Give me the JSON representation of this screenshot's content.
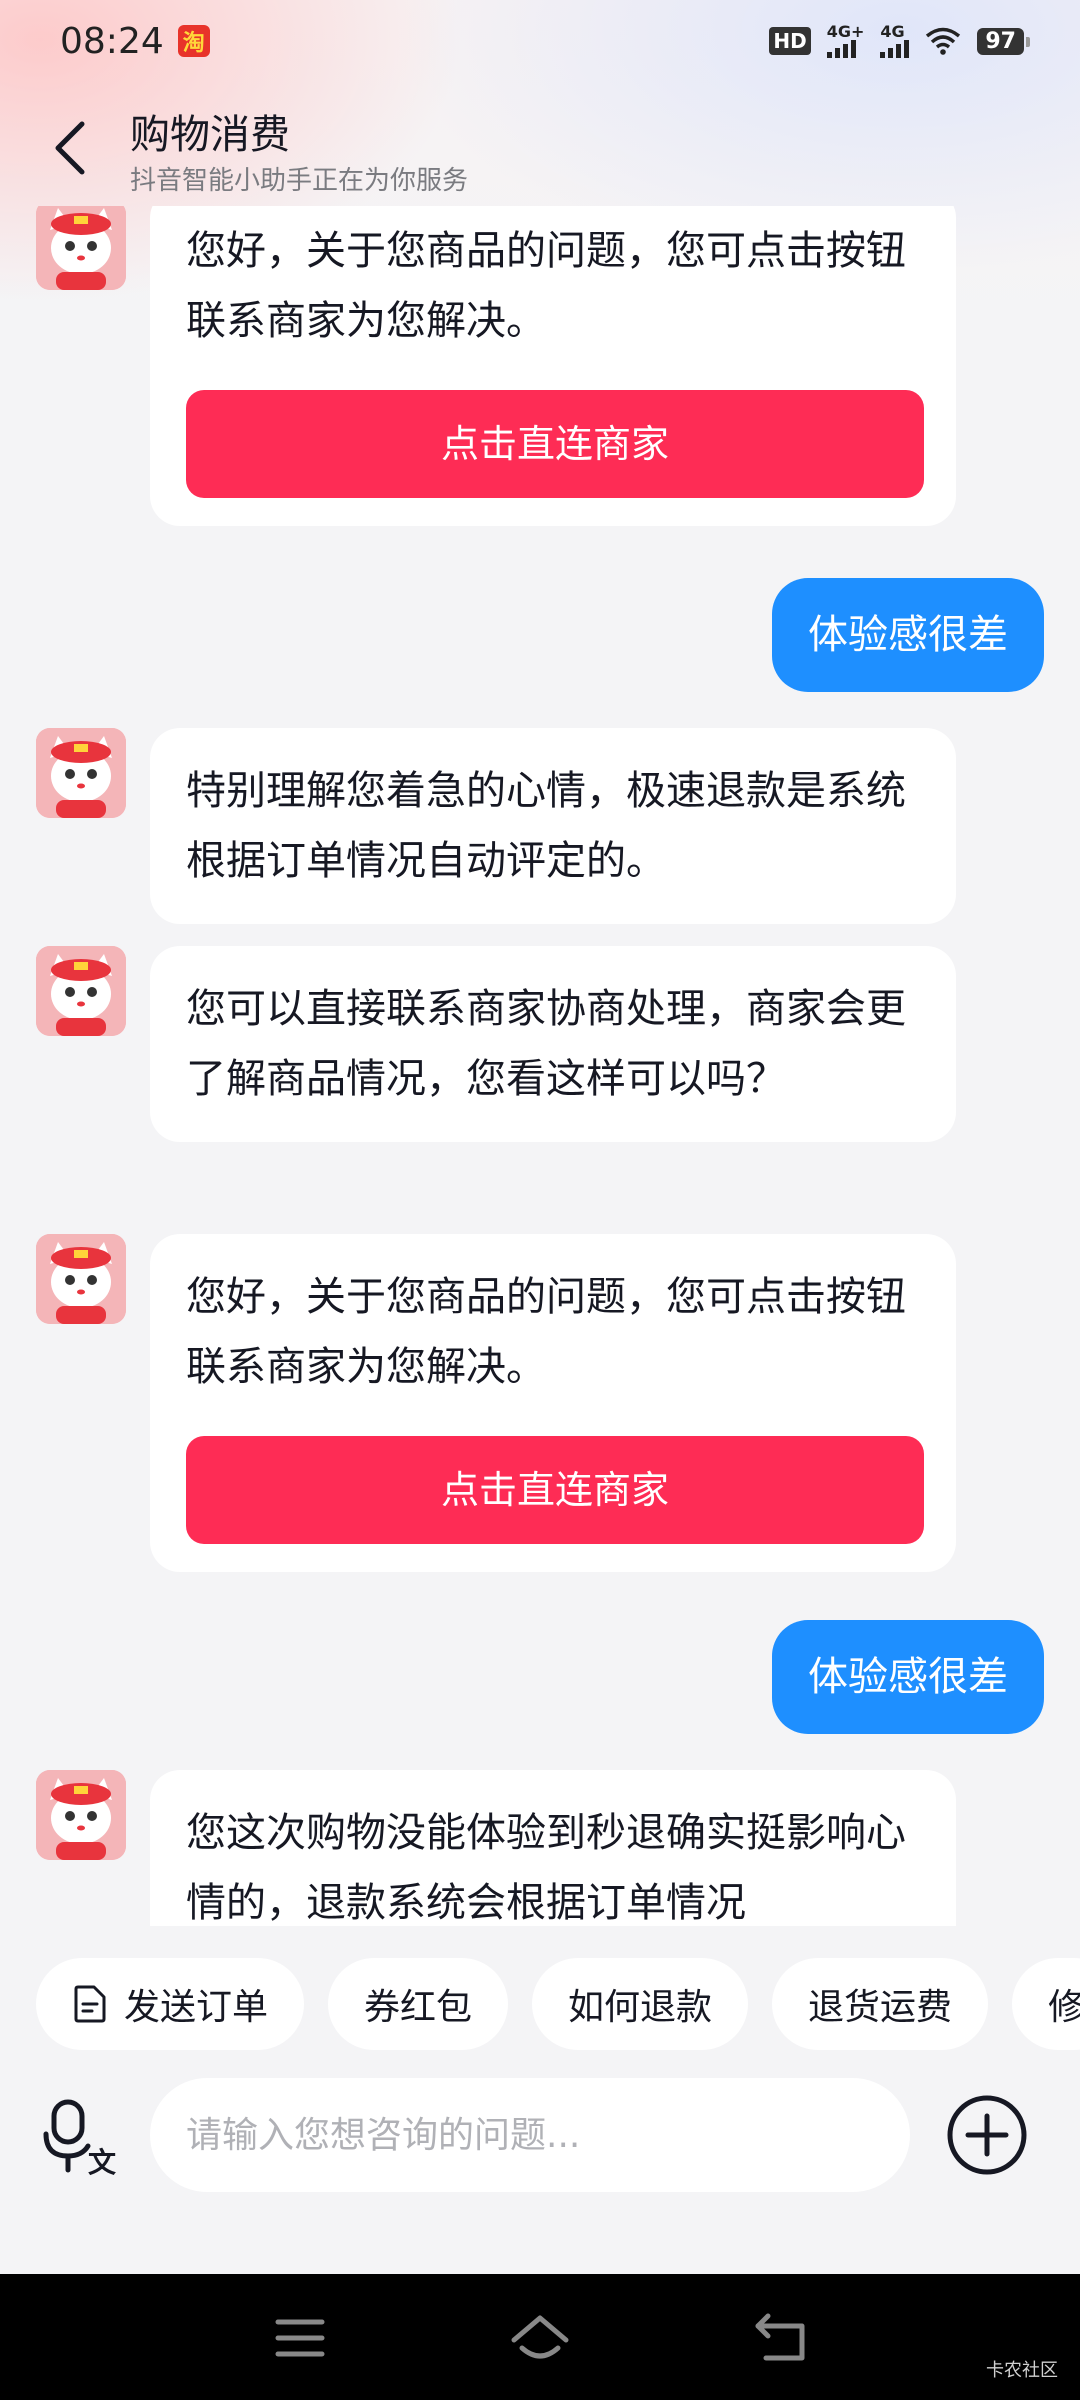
{
  "status_bar": {
    "time": "08:24",
    "app_icon_glyph": "淘",
    "hd_label": "HD",
    "signal1_label": "4G+",
    "signal2_label": "4G",
    "battery": "97"
  },
  "header": {
    "title": "购物消费",
    "subtitle": "抖音智能小助手正在为你服务"
  },
  "messages": [
    {
      "sender": "bot",
      "text": "您好，关于您商品的问题，您可点击按钮联系商家为您解决。",
      "button": "点击直连商家"
    },
    {
      "sender": "user",
      "text": "体验感很差"
    },
    {
      "sender": "bot",
      "text": "特别理解您着急的心情，极速退款是系统根据订单情况自动评定的。"
    },
    {
      "sender": "bot",
      "text": "您可以直接联系商家协商处理，商家会更了解商品情况，您看这样可以吗？"
    },
    {
      "sender": "bot",
      "text": "您好，关于您商品的问题，您可点击按钮联系商家为您解决。",
      "button": "点击直连商家"
    },
    {
      "sender": "user",
      "text": "体验感很差"
    },
    {
      "sender": "bot",
      "text": "您这次购物没能体验到秒退确实挺影响心情的，退款系统会根据订单情况"
    }
  ],
  "quick_replies": [
    "发送订单",
    "券红包",
    "如何退款",
    "退货运费",
    "修"
  ],
  "input": {
    "placeholder": "请输入您想咨询的问题..."
  },
  "watermark": "卡农社区",
  "colors": {
    "accent_button": "#fe2c55",
    "user_bubble": "#1e8fff",
    "background": "#f4f4f6"
  },
  "icons": {
    "back": "chevron-left-icon",
    "voice": "microphone-translate-icon",
    "plus": "plus-circle-icon",
    "order": "document-icon"
  }
}
